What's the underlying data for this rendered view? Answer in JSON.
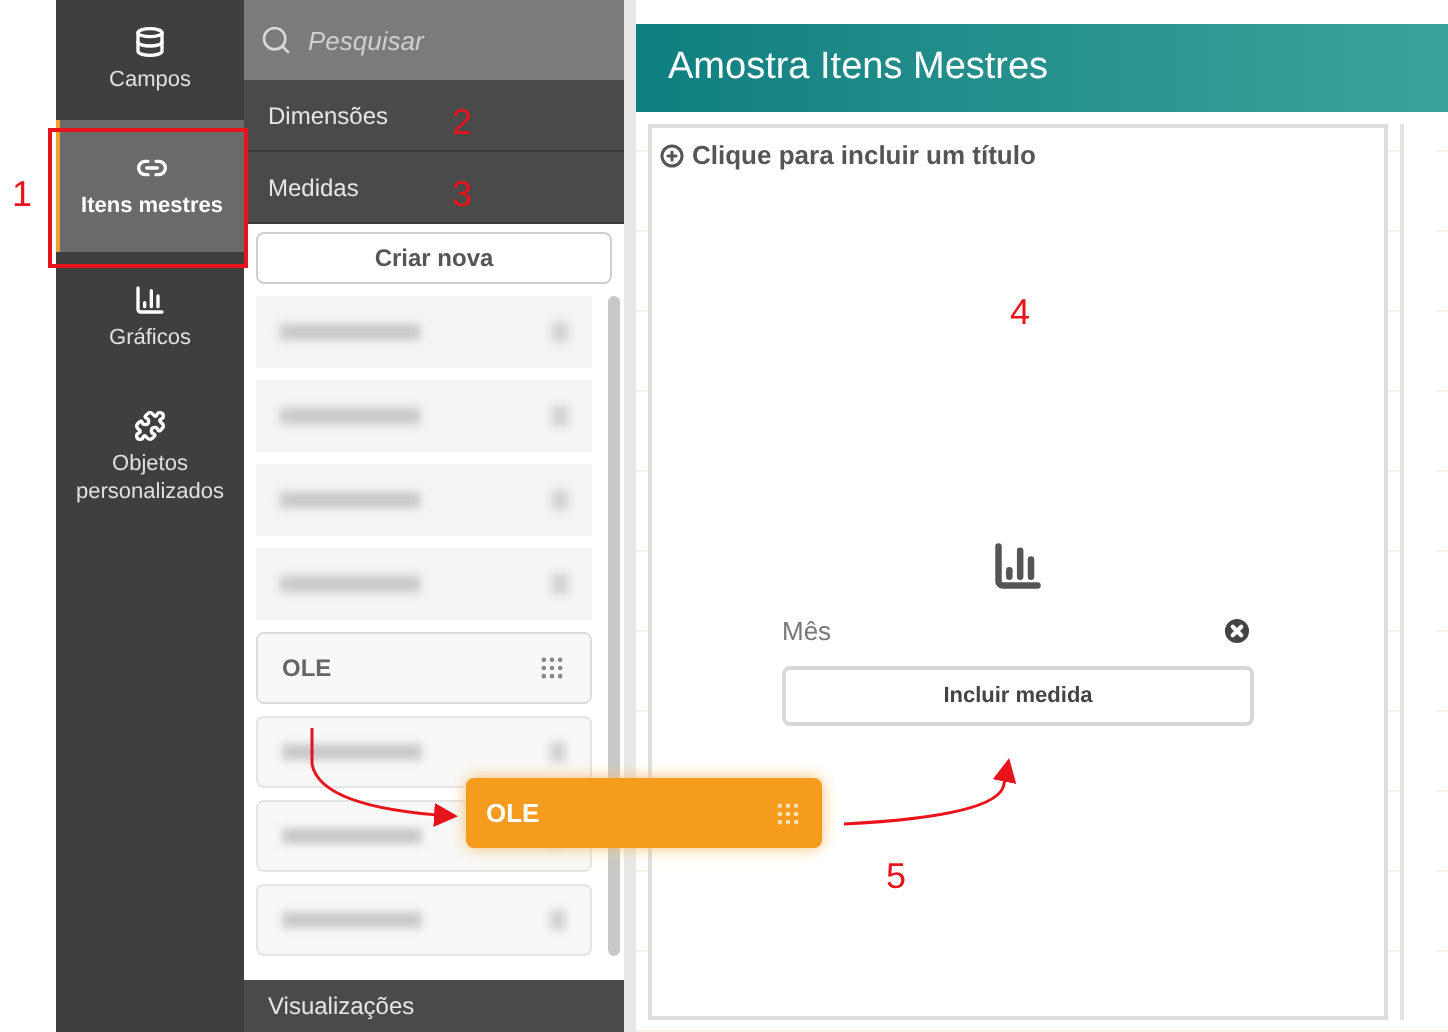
{
  "sidebar": {
    "items": [
      {
        "label": "Campos",
        "selected": false
      },
      {
        "label": "Itens mestres",
        "selected": true
      },
      {
        "label": "Gráficos",
        "selected": false
      },
      {
        "label": "Objetos personalizados",
        "selected": false
      }
    ]
  },
  "panel": {
    "search": {
      "placeholder": "Pesquisar"
    },
    "sections": [
      "Dimensões",
      "Medidas"
    ],
    "create_button": "Criar nova",
    "items": [
      {
        "kind": "blurred"
      },
      {
        "kind": "blurred"
      },
      {
        "kind": "blurred"
      },
      {
        "kind": "blurred"
      },
      {
        "kind": "item",
        "label": "OLE"
      },
      {
        "kind": "blurred"
      },
      {
        "kind": "blurred"
      },
      {
        "kind": "blurred"
      }
    ],
    "footer": "Visualizações"
  },
  "sheet": {
    "title": "Amostra Itens Mestres",
    "card": {
      "title_prompt": "Clique para incluir um título",
      "dimension": "Mês",
      "add_button": "Incluir medida"
    }
  },
  "drag_ghost": {
    "label": "OLE"
  },
  "annotations": [
    "1",
    "2",
    "3",
    "4",
    "5"
  ]
}
